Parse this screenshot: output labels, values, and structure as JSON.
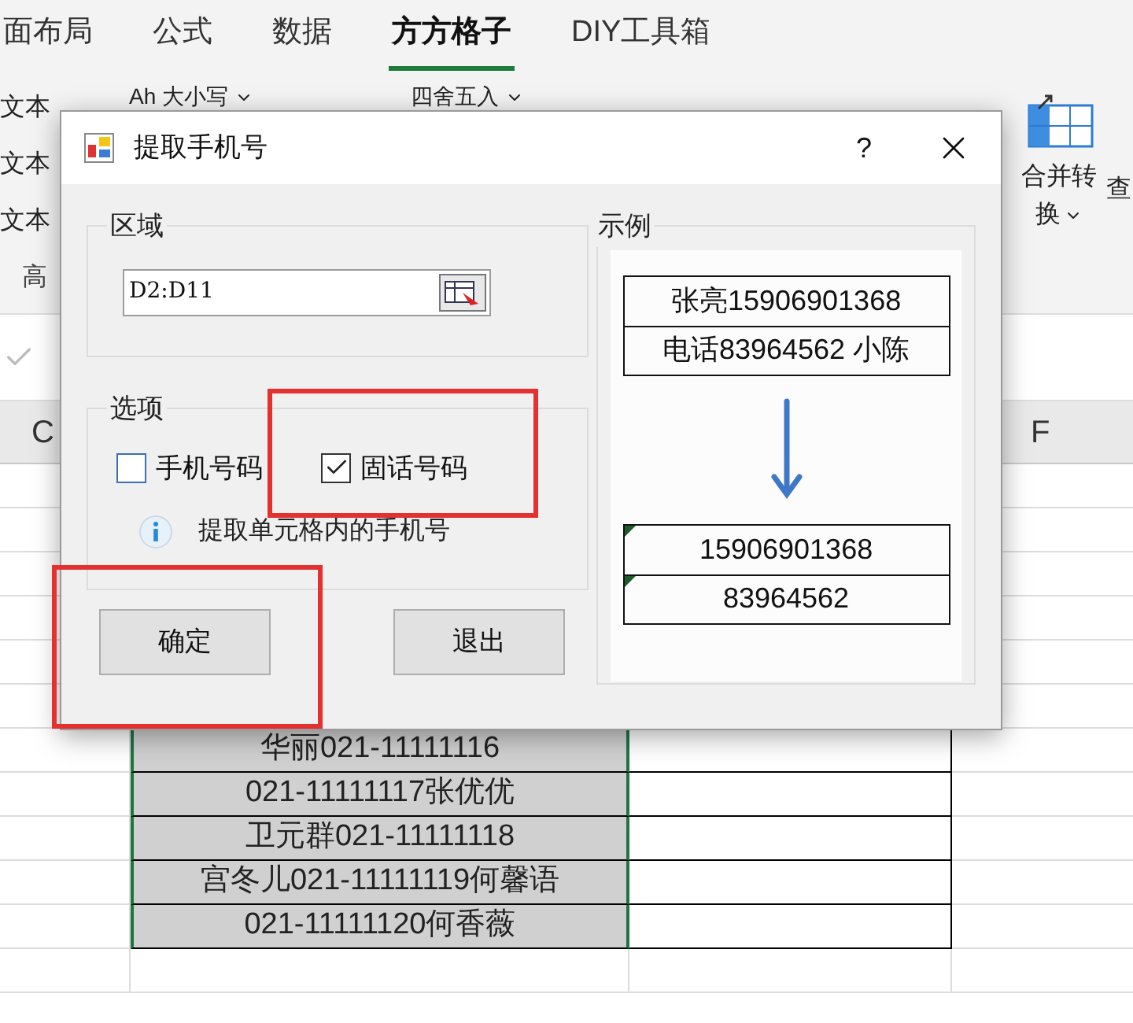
{
  "ribbon_tabs": [
    {
      "label": "面布局",
      "selected": false
    },
    {
      "label": "公式",
      "selected": false
    },
    {
      "label": "数据",
      "selected": false
    },
    {
      "label": "方方格子",
      "selected": true
    },
    {
      "label": "DIY工具箱",
      "selected": false
    }
  ],
  "ribbon": {
    "left_items": [
      "文本",
      "文本",
      "文本"
    ],
    "group_label": "高",
    "case_button": "Ah 大小写",
    "round_button": "四舍五入",
    "merge_button": [
      "合并转",
      "换"
    ],
    "cut_button": "查"
  },
  "sheet": {
    "columns": [
      "C",
      "F"
    ],
    "cells": [
      "华丽021-11111116",
      "021-11111117张优优",
      "卫元群021-11111118",
      "宫冬儿021-11111119何馨语",
      "021-11111120何香薇"
    ]
  },
  "dialog": {
    "title": "提取手机号",
    "help": "?",
    "region": {
      "label": "区域",
      "value": "D2:D11"
    },
    "options": {
      "label": "选项",
      "checkboxes": [
        {
          "label": "手机号码",
          "checked": false,
          "highlighted": false
        },
        {
          "label": "固话号码",
          "checked": true,
          "highlighted": true
        }
      ],
      "info": "提取单元格内的手机号"
    },
    "buttons": [
      {
        "label": "确定",
        "highlighted": true
      },
      {
        "label": "退出",
        "highlighted": false
      }
    ],
    "example": {
      "label": "示例",
      "input_lines": [
        "张亮15906901368",
        "电话83964562 小陈"
      ],
      "output_lines": [
        "15906901368",
        "83964562"
      ]
    }
  }
}
